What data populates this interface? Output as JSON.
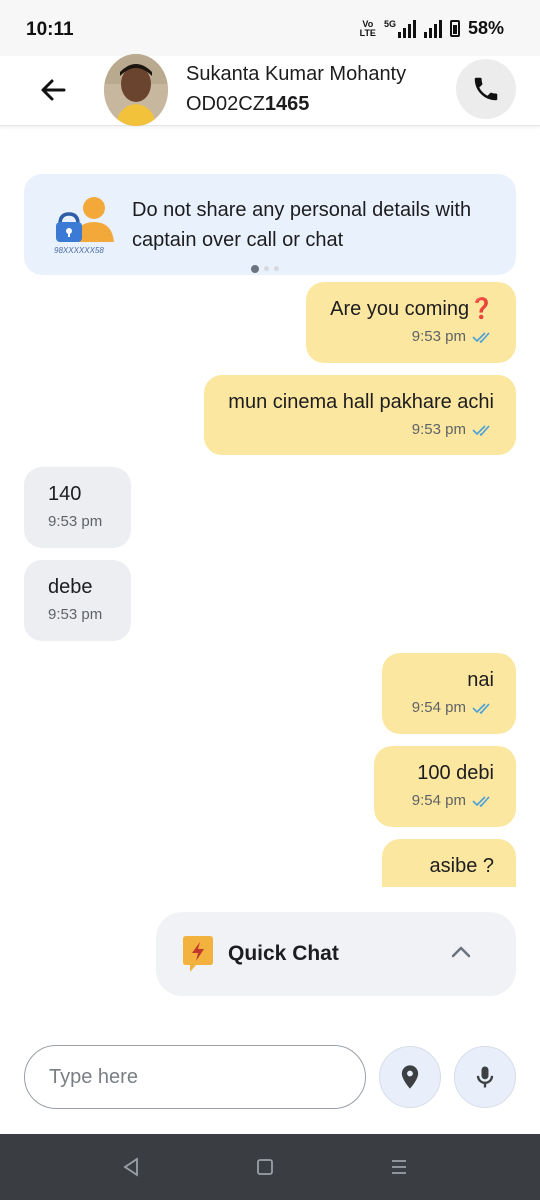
{
  "status_bar": {
    "time": "10:11",
    "network_top": "Vo",
    "network_bottom": "LTE",
    "gen": "5G",
    "battery": "58%"
  },
  "header": {
    "contact_name": "Sukanta Kumar Mohanty",
    "vehicle_prefix": "OD02CZ",
    "vehicle_suffix": "1465"
  },
  "notice": {
    "masked_number": "98XXXXXX58",
    "text": "Do not share any personal details with captain over call or chat"
  },
  "messages": [
    {
      "dir": "out",
      "text": "Are you coming❓",
      "time": "9:53 pm"
    },
    {
      "dir": "out",
      "text": "mun cinema hall pakhare achi",
      "time": "9:53 pm"
    },
    {
      "dir": "in",
      "text": "140",
      "time": "9:53 pm"
    },
    {
      "dir": "in",
      "text": "debe",
      "time": "9:53 pm"
    },
    {
      "dir": "out",
      "text": "nai",
      "time": "9:54 pm"
    },
    {
      "dir": "out",
      "text": "100 debi",
      "time": "9:54 pm"
    },
    {
      "dir": "out",
      "text": "asibe ?",
      "time": ""
    }
  ],
  "quick_chat": {
    "label": "Quick Chat"
  },
  "composer": {
    "placeholder": "Type here"
  },
  "colors": {
    "outgoing_bubble": "#fbe7a0",
    "incoming_bubble": "#eceef1",
    "read_tick": "#4a9fd8",
    "notice_bg": "#e9f1fc"
  },
  "icons": {
    "back": "arrow-left-icon",
    "call": "phone-icon",
    "notice": "lock-user-icon",
    "read": "double-check-icon",
    "quick_chat": "lightning-bubble-icon",
    "expand": "chevron-up-icon",
    "location": "location-pin-icon",
    "mic": "microphone-icon"
  }
}
